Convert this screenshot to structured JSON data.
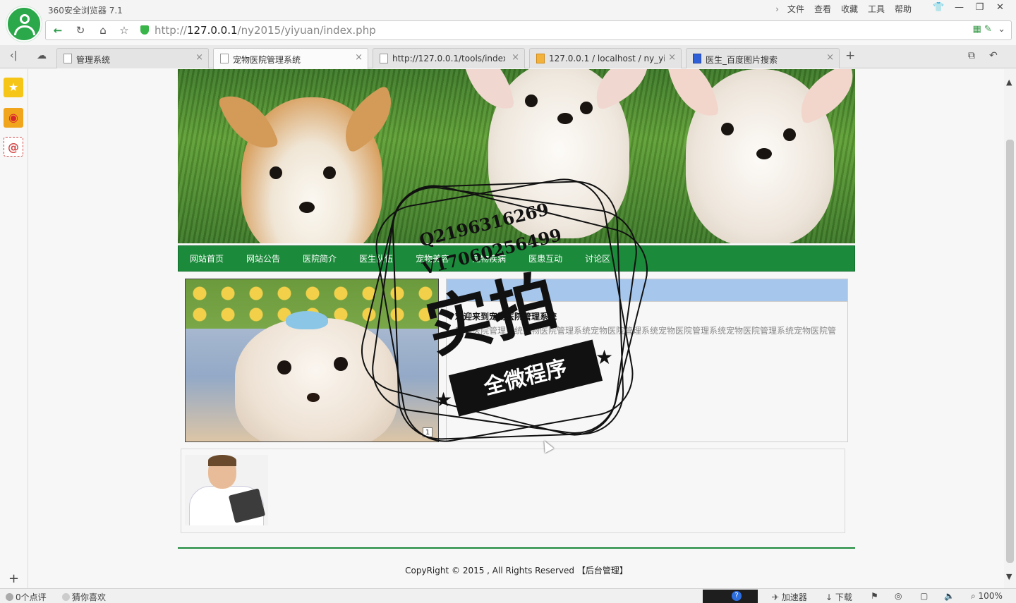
{
  "browser": {
    "app_title": "360安全浏览器 7.1",
    "menu": [
      "文件",
      "查看",
      "收藏",
      "工具",
      "帮助"
    ],
    "url_prefix": "http://",
    "url_host": "127.0.0.1",
    "url_path": "/ny2015/yiyuan/index.php"
  },
  "tabs": [
    {
      "label": "管理系统",
      "icon": "page-icon"
    },
    {
      "label": "宠物医院管理系统",
      "icon": "page-icon",
      "active": true
    },
    {
      "label": "http://127.0.0.1/tools/index_",
      "icon": "page-icon"
    },
    {
      "label": "127.0.0.1 / localhost / ny_yiy",
      "icon": "phpmyadmin-icon"
    },
    {
      "label": "医生_百度图片搜索",
      "icon": "baidu-icon"
    }
  ],
  "site": {
    "nav": [
      "网站首页",
      "网站公告",
      "医院简介",
      "医生队伍",
      "宠物美容",
      "宠物疾病",
      "医患互动",
      "讨论区"
    ],
    "notice_header": "",
    "notice_title": "欢迎来到宠物医院管理系统",
    "notice_text": "宠物医院管理系统宠物医院管理系统宠物医院管理系统宠物医院管理系统宠物医院管理系统宠物医院管",
    "slide_number": "1",
    "copyright": "CopyRight © 2015 , All Rights Reserved 【后台管理】"
  },
  "watermark": {
    "qq": "Q2196316269",
    "vx": "V17060256499",
    "big": "实拍",
    "ribbon": "全微程序"
  },
  "statusbar": {
    "comments": "0个点评",
    "guess": "猜你喜欢",
    "accelerator": "加速器",
    "download": "下载",
    "zoom": "100%"
  }
}
